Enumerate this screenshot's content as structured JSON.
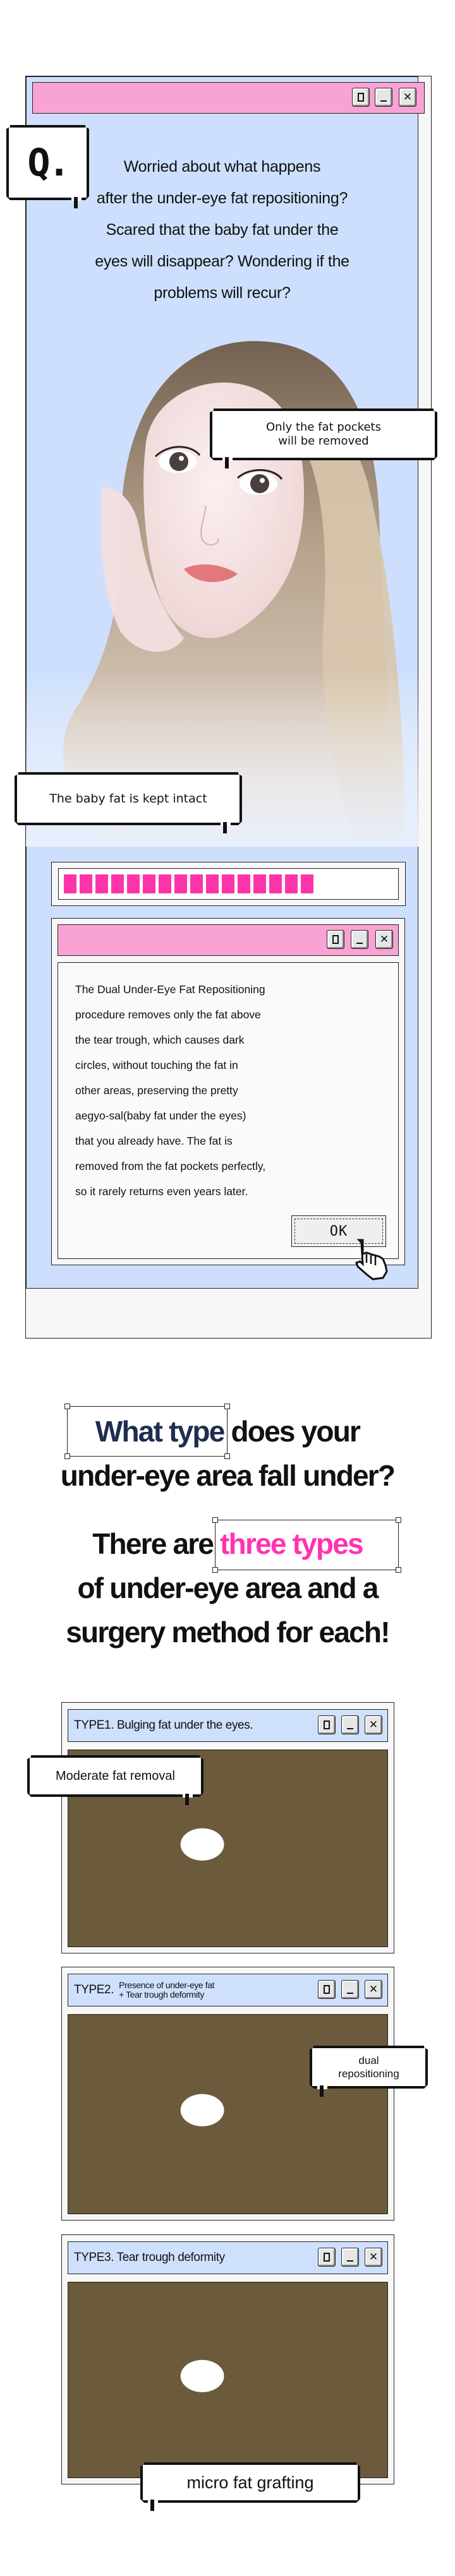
{
  "colors": {
    "title_pink": "#f9a3d4",
    "panel_blue": "#cddffc",
    "progress_pink": "#ff33aa",
    "heading_navy": "#1e2d50",
    "heading_pink": "#ff33b0"
  },
  "main_window": {
    "controls": [
      "maximize-icon",
      "minimize-icon",
      "close-icon"
    ],
    "q_badge": "Q.",
    "question_lines": [
      "Worried about what happens",
      "after the under-eye fat repositioning?",
      "Scared that the baby fat under the",
      "eyes will disappear? Wondering if the",
      "problems will recur?"
    ],
    "bubble_top_lines": [
      "Only the fat pockets",
      "will be removed"
    ],
    "bubble_bottom": "The baby fat is kept intact",
    "progress": {
      "filled_blocks": 16,
      "total_blocks": 21,
      "percent": 76
    }
  },
  "dialog": {
    "body_lines": [
      "The Dual Under-Eye Fat Repositioning",
      "procedure removes  only the fat above",
      "the tear trough, which causes dark",
      "circles,  without touching the fat in",
      "other areas, preserving the pretty",
      "aegyo-sal(baby fat under the eyes)",
      "that you already have.  The fat is",
      "removed from the fat pockets perfectly,",
      "so it rarely returns even years later."
    ],
    "ok_label": "OK"
  },
  "headline": {
    "q1_highlight": "What type",
    "q1_rest": "does your",
    "q1_line2": "under-eye area fall under?",
    "a_prefix": "There are",
    "a_highlight": "three types",
    "a_line2": "of under-eye area and a",
    "a_line3": "surgery method for each!"
  },
  "types": [
    {
      "title": "TYPE1. Bulging fat under the eyes.",
      "bubble": "Moderate fat removal"
    },
    {
      "title_prefix": "TYPE2.",
      "title_lines": [
        "Presence of under-eye fat",
        "+ Tear trough deformity"
      ],
      "bubble_lines": [
        "dual",
        "repositioning"
      ]
    },
    {
      "title": "TYPE3. Tear trough deformity",
      "bubble": "micro fat grafting"
    }
  ]
}
